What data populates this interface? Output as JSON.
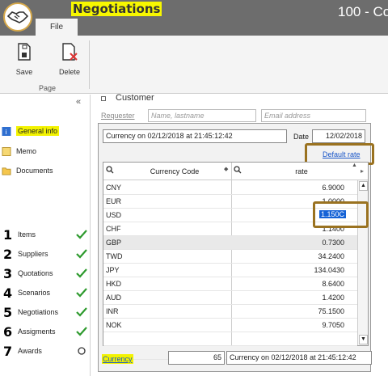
{
  "app": {
    "title": "Negotiations",
    "window_title": "100 - Co",
    "file_tab": "File"
  },
  "ribbon": {
    "save_label": "Save",
    "delete_label": "Delete",
    "group_label": "Page"
  },
  "sidebar": {
    "collapse_glyph": "«",
    "items": [
      {
        "label": "General info",
        "icon": "info-icon"
      },
      {
        "label": "Memo",
        "icon": "memo-icon"
      },
      {
        "label": "Documents",
        "icon": "folder-icon"
      }
    ],
    "steps": [
      {
        "num": "1",
        "label": "Items",
        "status": "done"
      },
      {
        "num": "2",
        "label": "Suppliers",
        "status": "done"
      },
      {
        "num": "3",
        "label": "Quotations",
        "status": "done"
      },
      {
        "num": "4",
        "label": "Scenarios",
        "status": "done"
      },
      {
        "num": "5",
        "label": "Negotiations",
        "status": "done"
      },
      {
        "num": "6",
        "label": "Assigments",
        "status": "done"
      },
      {
        "num": "7",
        "label": "Awards",
        "status": "pending"
      }
    ]
  },
  "main": {
    "section_title": "Customer",
    "requester_label": "Requester",
    "name_placeholder": "Name, lastname",
    "email_placeholder": "Email address"
  },
  "popup": {
    "currency_desc": "Currency on 02/12/2018 at 21:45:12:42",
    "date_label": "Date",
    "date_value": "12/02/2018",
    "default_rate_link": "Default rate",
    "grid": {
      "col_code": "Currency Code",
      "col_rate": "rate",
      "rows": [
        {
          "code": "CNY",
          "rate": "6.9000"
        },
        {
          "code": "EUR",
          "rate": "1.0000"
        },
        {
          "code": "USD",
          "rate": "1.150C"
        },
        {
          "code": "CHF",
          "rate": "1.1400"
        },
        {
          "code": "GBP",
          "rate": "0.7300"
        },
        {
          "code": "TWD",
          "rate": "34.2400"
        },
        {
          "code": "JPY",
          "rate": "134.0430"
        },
        {
          "code": "HKD",
          "rate": "8.6400"
        },
        {
          "code": "AUD",
          "rate": "1.4200"
        },
        {
          "code": "INR",
          "rate": "75.1500"
        },
        {
          "code": "NOK",
          "rate": "9.7050"
        },
        {
          "code": "",
          "rate": ""
        },
        {
          "code": "",
          "rate": ""
        }
      ]
    }
  },
  "footer": {
    "currency_link": "Currency",
    "count": "65",
    "currency_desc": "Currency on 02/12/2018 at 21:45:12:42"
  },
  "colors": {
    "highlight": "#f3f300",
    "annotation_box": "#9a7220",
    "link": "#1a56c8",
    "check": "#2e9a2e",
    "selected_cell": "#1462d6"
  }
}
